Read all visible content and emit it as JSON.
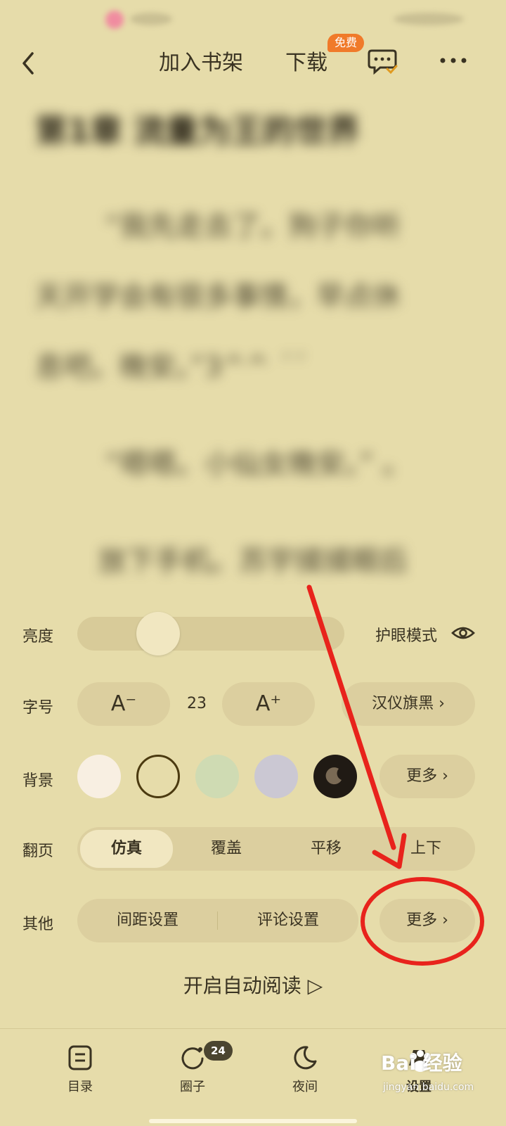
{
  "header": {
    "add_shelf": "加入书架",
    "download": "下载",
    "free_badge": "免费"
  },
  "reading": {
    "chapter_title": "第1章 流量为王的世界",
    "paragraphs": [
      "“我先走去了。狗子你听",
      "天开学会有很多事情，早点休",
      "息吧。晚安。”3^^ ˊˊ",
      "“嗯嗯。小仙女晚安。” 。",
      "放下手机。苏宇揉揉眼后"
    ]
  },
  "settings": {
    "brightness_label": "亮度",
    "brightness_level": 0.28,
    "eye_mode_label": "护眼模式",
    "font_size_label": "字号",
    "font_decrease": "A⁻",
    "font_size_value": "23",
    "font_increase": "A⁺",
    "font_family": "汉仪旗黑 ›",
    "background_label": "背景",
    "background_swatches": [
      "#f8efe2",
      "#e6dcaa",
      "#cfdbb3",
      "#cbc8d3",
      "#201a14"
    ],
    "background_more": "更多 ›",
    "page_turn_label": "翻页",
    "page_turn_options": [
      "仿真",
      "覆盖",
      "平移",
      "上下"
    ],
    "page_turn_selected": "仿真",
    "other_label": "其他",
    "spacing_settings": "间距设置",
    "comment_settings": "评论设置",
    "other_more": "更多 ›",
    "auto_read": "开启自动阅读 ▷"
  },
  "nav": {
    "toc": "目录",
    "circle": "圈子",
    "circle_badge": "24",
    "night": "夜间",
    "settings": "设置"
  },
  "watermark": {
    "brand": "Bai 经验",
    "url": "jingyan.baidu.com"
  },
  "colors": {
    "background": "#e6dcaa",
    "annotation_red": "#e8231c",
    "badge_orange": "#f07a2a"
  }
}
